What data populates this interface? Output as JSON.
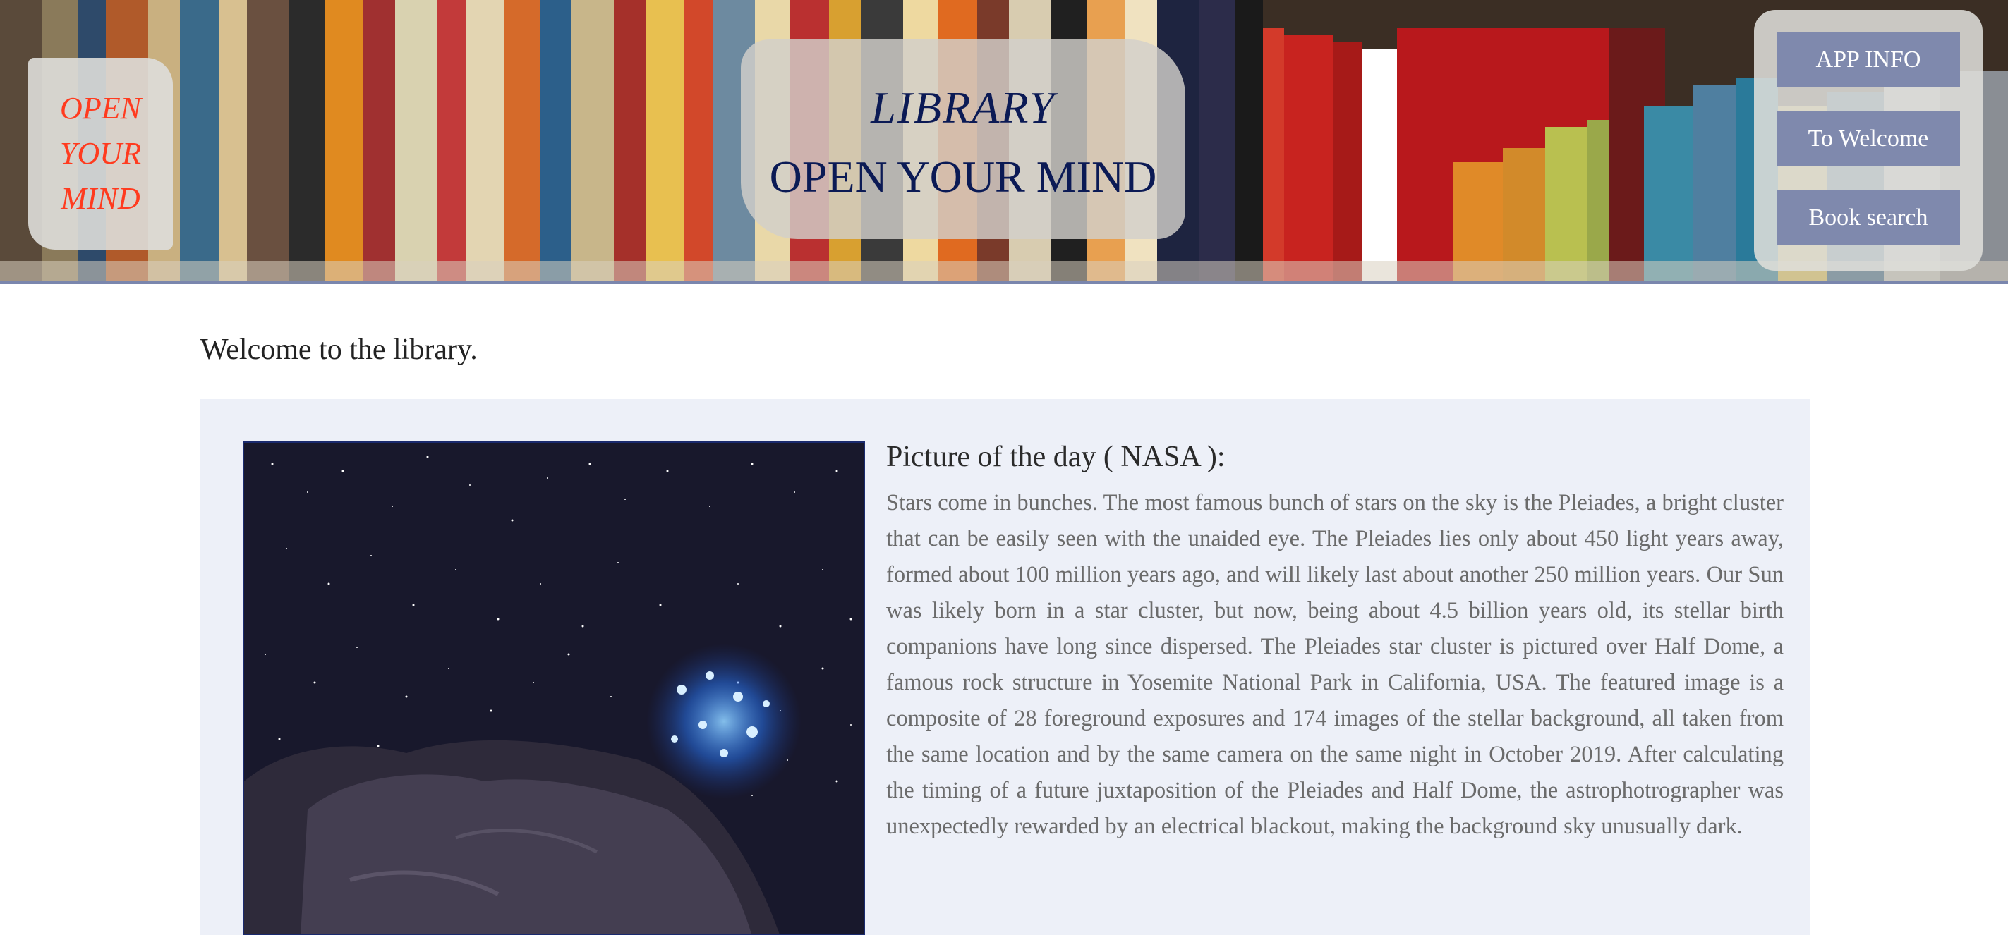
{
  "header": {
    "badge_text": "OPEN YOUR MIND",
    "title": "LIBRARY",
    "subtitle": "OPEN YOUR MIND",
    "nav": [
      {
        "label": "APP INFO"
      },
      {
        "label": "To Welcome"
      },
      {
        "label": "Book search"
      }
    ]
  },
  "main": {
    "welcome": "Welcome to the library.",
    "picture_heading": "Picture of the day ( NASA ):",
    "picture_description": "Stars come in bunches. The most famous bunch of stars on the sky is the Pleiades, a bright cluster that can be easily seen with the unaided eye. The Pleiades lies only about 450 light years away, formed about 100 million years ago, and will likely last about another 250 million years. Our Sun was likely born in a star cluster, but now, being about 4.5 billion years old, its stellar birth companions have long since dispersed. The Pleiades star cluster is pictured over Half Dome, a famous rock structure in Yosemite National Park in California, USA. The featured image is a composite of 28 foreground exposures and 174 images of the stellar background, all taken from the same location and by the same camera on the same night in October 2019. After calculating the timing of a future juxtaposition of the Pleiades and Half Dome, the astrophotrographer was unexpectedly rewarded by an electrical blackout, making the background sky unusually dark."
  },
  "colors": {
    "accent": "#7f89ad",
    "title": "#0b1a55",
    "badge_text": "#ff3b1f",
    "card_bg": "#edf0f8"
  }
}
